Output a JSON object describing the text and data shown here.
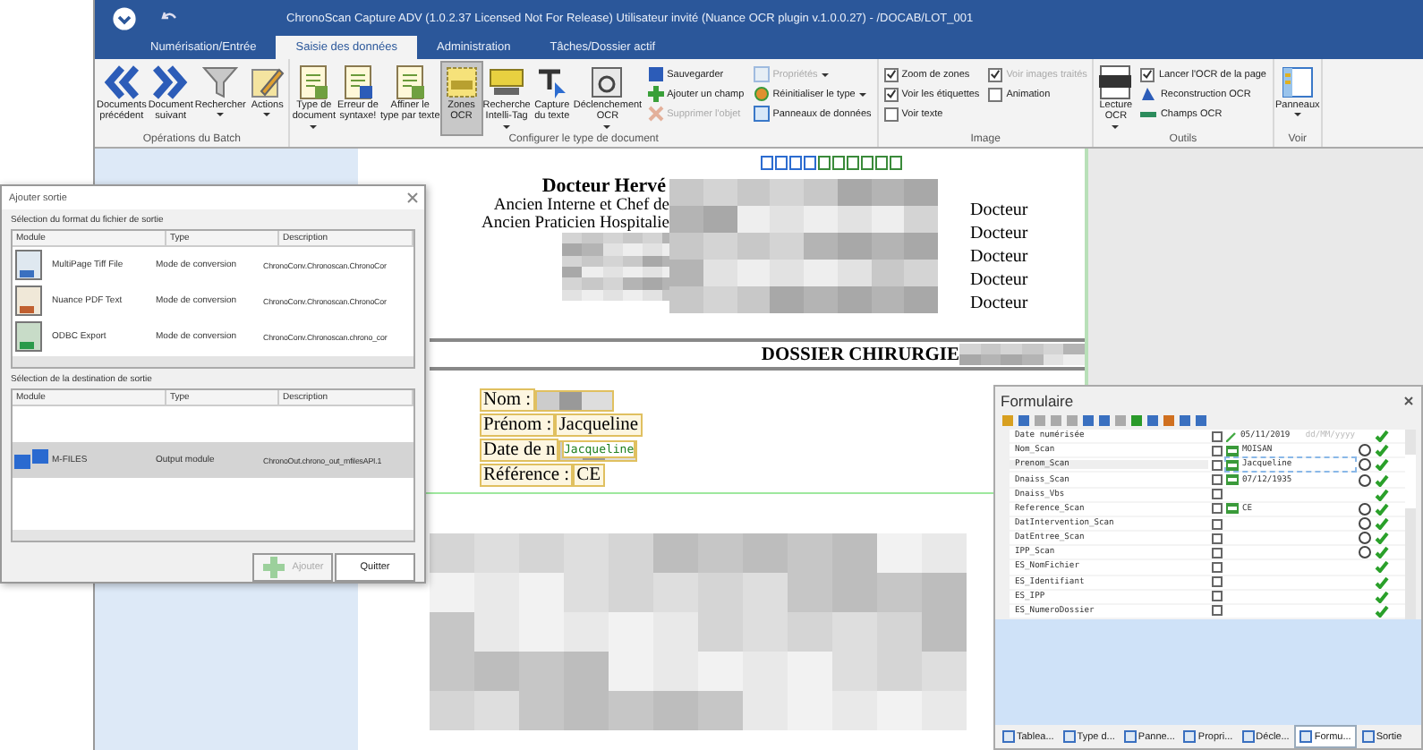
{
  "window": {
    "title": "ChronoScan Capture ADV (1.0.2.37 Licensed Not For Release) Utilisateur invité (Nuance OCR plugin v.1.0.0.27) - /DOCAB/LOT_001"
  },
  "ribbon_tabs": [
    {
      "label": "Numérisation/Entrée",
      "selected": false
    },
    {
      "label": "Saisie des données",
      "selected": true
    },
    {
      "label": "Administration",
      "selected": false
    },
    {
      "label": "Tâches/Dossier actif",
      "selected": false
    }
  ],
  "ribbon_groups": [
    {
      "label": "Opérations du Batch",
      "items": [
        {
          "kind": "large",
          "label": "Documents\nprécédent",
          "dropdown": false,
          "selected": false,
          "disabled": false
        },
        {
          "kind": "large",
          "label": "Document\nsuivant",
          "dropdown": false,
          "selected": false,
          "disabled": false
        },
        {
          "kind": "large",
          "label": "Rechercher",
          "dropdown": true,
          "selected": false,
          "disabled": false
        },
        {
          "kind": "large",
          "label": "Actions",
          "dropdown": true,
          "selected": false,
          "disabled": false
        }
      ]
    },
    {
      "label": "Configurer le type de document",
      "items": [
        {
          "kind": "large",
          "label": "Type de\ndocument",
          "dropdown": true,
          "selected": false,
          "disabled": false
        },
        {
          "kind": "large",
          "label": "Erreur de\nsyntaxe!",
          "dropdown": false,
          "selected": false,
          "disabled": false
        },
        {
          "kind": "large",
          "label": "Affiner le\ntype par texte",
          "dropdown": false,
          "selected": false,
          "disabled": false
        },
        {
          "kind": "large",
          "label": "Zones\nOCR",
          "dropdown": false,
          "selected": true,
          "disabled": false
        },
        {
          "kind": "large",
          "label": "Recherche\nIntelli-Tag",
          "dropdown": true,
          "selected": false,
          "disabled": false
        },
        {
          "kind": "large",
          "label": "Capture\ndu texte",
          "dropdown": false,
          "selected": false,
          "disabled": false
        },
        {
          "kind": "large",
          "label": "Déclenchement\nOCR",
          "dropdown": true,
          "selected": false,
          "disabled": false
        },
        {
          "kind": "small",
          "label": "Sauvegarder",
          "dropdown": false,
          "selected": false,
          "disabled": false
        },
        {
          "kind": "small",
          "label": "Ajouter un champ",
          "dropdown": false,
          "selected": false,
          "disabled": false
        },
        {
          "kind": "small",
          "label": "Supprimer l'objet",
          "dropdown": false,
          "selected": false,
          "disabled": true
        },
        {
          "kind": "small",
          "label": "Propriétés",
          "dropdown": true,
          "selected": false,
          "disabled": true
        },
        {
          "kind": "small",
          "label": "Réinitialiser le type",
          "dropdown": true,
          "selected": false,
          "disabled": false
        },
        {
          "kind": "small",
          "label": "Panneaux de données",
          "dropdown": false,
          "selected": false,
          "disabled": false
        }
      ]
    },
    {
      "label": "Image",
      "items": [
        {
          "kind": "check",
          "label": "Zoom de zones",
          "checked": true,
          "disabled": false
        },
        {
          "kind": "check",
          "label": "Voir les étiquettes",
          "checked": true,
          "disabled": false
        },
        {
          "kind": "check",
          "label": "Voir texte",
          "checked": false,
          "disabled": false
        },
        {
          "kind": "check",
          "label": "Voir images traités",
          "checked": true,
          "disabled": true
        },
        {
          "kind": "check",
          "label": "Animation",
          "checked": false,
          "disabled": false
        }
      ]
    },
    {
      "label": "Outils",
      "items": [
        {
          "kind": "large",
          "label": "Lecture\nOCR",
          "dropdown": true,
          "selected": false,
          "disabled": false
        },
        {
          "kind": "check",
          "label": "Lancer l'OCR de la page",
          "checked": true,
          "disabled": false
        },
        {
          "kind": "small",
          "label": "Reconstruction OCR",
          "dropdown": false,
          "selected": false,
          "disabled": false
        },
        {
          "kind": "small",
          "label": "Champs OCR",
          "dropdown": false,
          "selected": false,
          "disabled": false
        }
      ]
    },
    {
      "label": "Voir",
      "items": [
        {
          "kind": "large",
          "label": "Panneaux",
          "dropdown": true,
          "selected": false,
          "disabled": false
        }
      ]
    }
  ],
  "document": {
    "name": "Docteur Hervé",
    "lines": [
      "Ancien Interne et Chef de",
      "Ancien Praticien Hospitalie"
    ],
    "right_lines": [
      "Docteur",
      "Docteur",
      "Docteur",
      "Docteur",
      "Docteur"
    ],
    "banner": "DOSSIER CHIRURGIE",
    "fields": [
      {
        "label": "Nom :"
      },
      {
        "label": "Prénom :",
        "value": "Jacqueline"
      },
      {
        "label": "Date de n"
      },
      {
        "label": "Référence :",
        "value": "CE"
      }
    ],
    "ocr_text": "Jacqueline"
  },
  "dialog": {
    "title": "Ajouter sortie",
    "format_label": "Sélection du format du fichier de sortie",
    "format_columns": [
      "Module",
      "Type",
      "Description"
    ],
    "formats": [
      {
        "module": "MultiPage Tiff File",
        "type": "Mode de conversion",
        "description": "ChronoConv.Chronoscan.ChronoCor",
        "selected": false
      },
      {
        "module": "Nuance PDF Text",
        "type": "Mode de conversion",
        "description": "ChronoConv.Chronoscan.ChronoCor",
        "selected": false
      },
      {
        "module": "ODBC Export",
        "type": "Mode de conversion",
        "description": "ChronoConv.Chronoscan.chrono_cor",
        "selected": false
      }
    ],
    "destination_label": "Sélection de la destination de sortie",
    "destination_columns": [
      "Module",
      "Type",
      "Description"
    ],
    "destinations": [
      {
        "module": "M-FILES",
        "type": "Output module",
        "description": "ChronoOut.chrono_out_mfilesAPI.1",
        "selected": true
      }
    ],
    "buttons": [
      {
        "label": "Ajouter",
        "disabled": true
      },
      {
        "label": "Quitter",
        "disabled": false
      }
    ]
  },
  "form_panel": {
    "title": "Formulaire",
    "rows": [
      {
        "name": "Date numérisée",
        "value": "05/11/2019",
        "placeholder": "dd/MM/yyyy",
        "ocr": false,
        "hand": false,
        "valid": true,
        "selected": false
      },
      {
        "name": "Nom_Scan",
        "value": "MOISAN",
        "ocr": true,
        "hand": true,
        "valid": true,
        "selected": false
      },
      {
        "name": "Prenom_Scan",
        "value": "Jacqueline",
        "ocr": true,
        "hand": true,
        "valid": true,
        "selected": true
      },
      {
        "name": "Dnaiss_Scan",
        "value": "07/12/1935",
        "ocr": true,
        "hand": true,
        "valid": true,
        "selected": false
      },
      {
        "name": "Dnaiss_Vbs",
        "ocr": false,
        "hand": false,
        "valid": true,
        "selected": false
      },
      {
        "name": "Reference_Scan",
        "value": "CE",
        "ocr": true,
        "hand": true,
        "valid": true,
        "selected": false
      },
      {
        "name": "DatIntervention_Scan",
        "ocr": false,
        "hand": true,
        "valid": true,
        "selected": false
      },
      {
        "name": "DatEntree_Scan",
        "ocr": false,
        "hand": true,
        "valid": true,
        "selected": false
      },
      {
        "name": "IPP_Scan",
        "ocr": false,
        "hand": true,
        "valid": true,
        "selected": false
      },
      {
        "name": "ES_NomFichier",
        "ocr": false,
        "hand": false,
        "valid": true,
        "selected": false
      },
      {
        "name": "ES_Identifiant",
        "ocr": false,
        "hand": false,
        "valid": true,
        "selected": false
      },
      {
        "name": "ES_IPP",
        "ocr": false,
        "hand": false,
        "valid": true,
        "selected": false
      },
      {
        "name": "ES_NumeroDossier",
        "ocr": false,
        "hand": false,
        "valid": true,
        "selected": false
      }
    ],
    "tabs": [
      {
        "label": "Tablea...",
        "selected": false
      },
      {
        "label": "Type d...",
        "selected": false
      },
      {
        "label": "Panne...",
        "selected": false
      },
      {
        "label": "Propri...",
        "selected": false
      },
      {
        "label": "Décle...",
        "selected": false
      },
      {
        "label": "Formu...",
        "selected": true
      },
      {
        "label": "Sortie",
        "selected": false
      }
    ]
  }
}
